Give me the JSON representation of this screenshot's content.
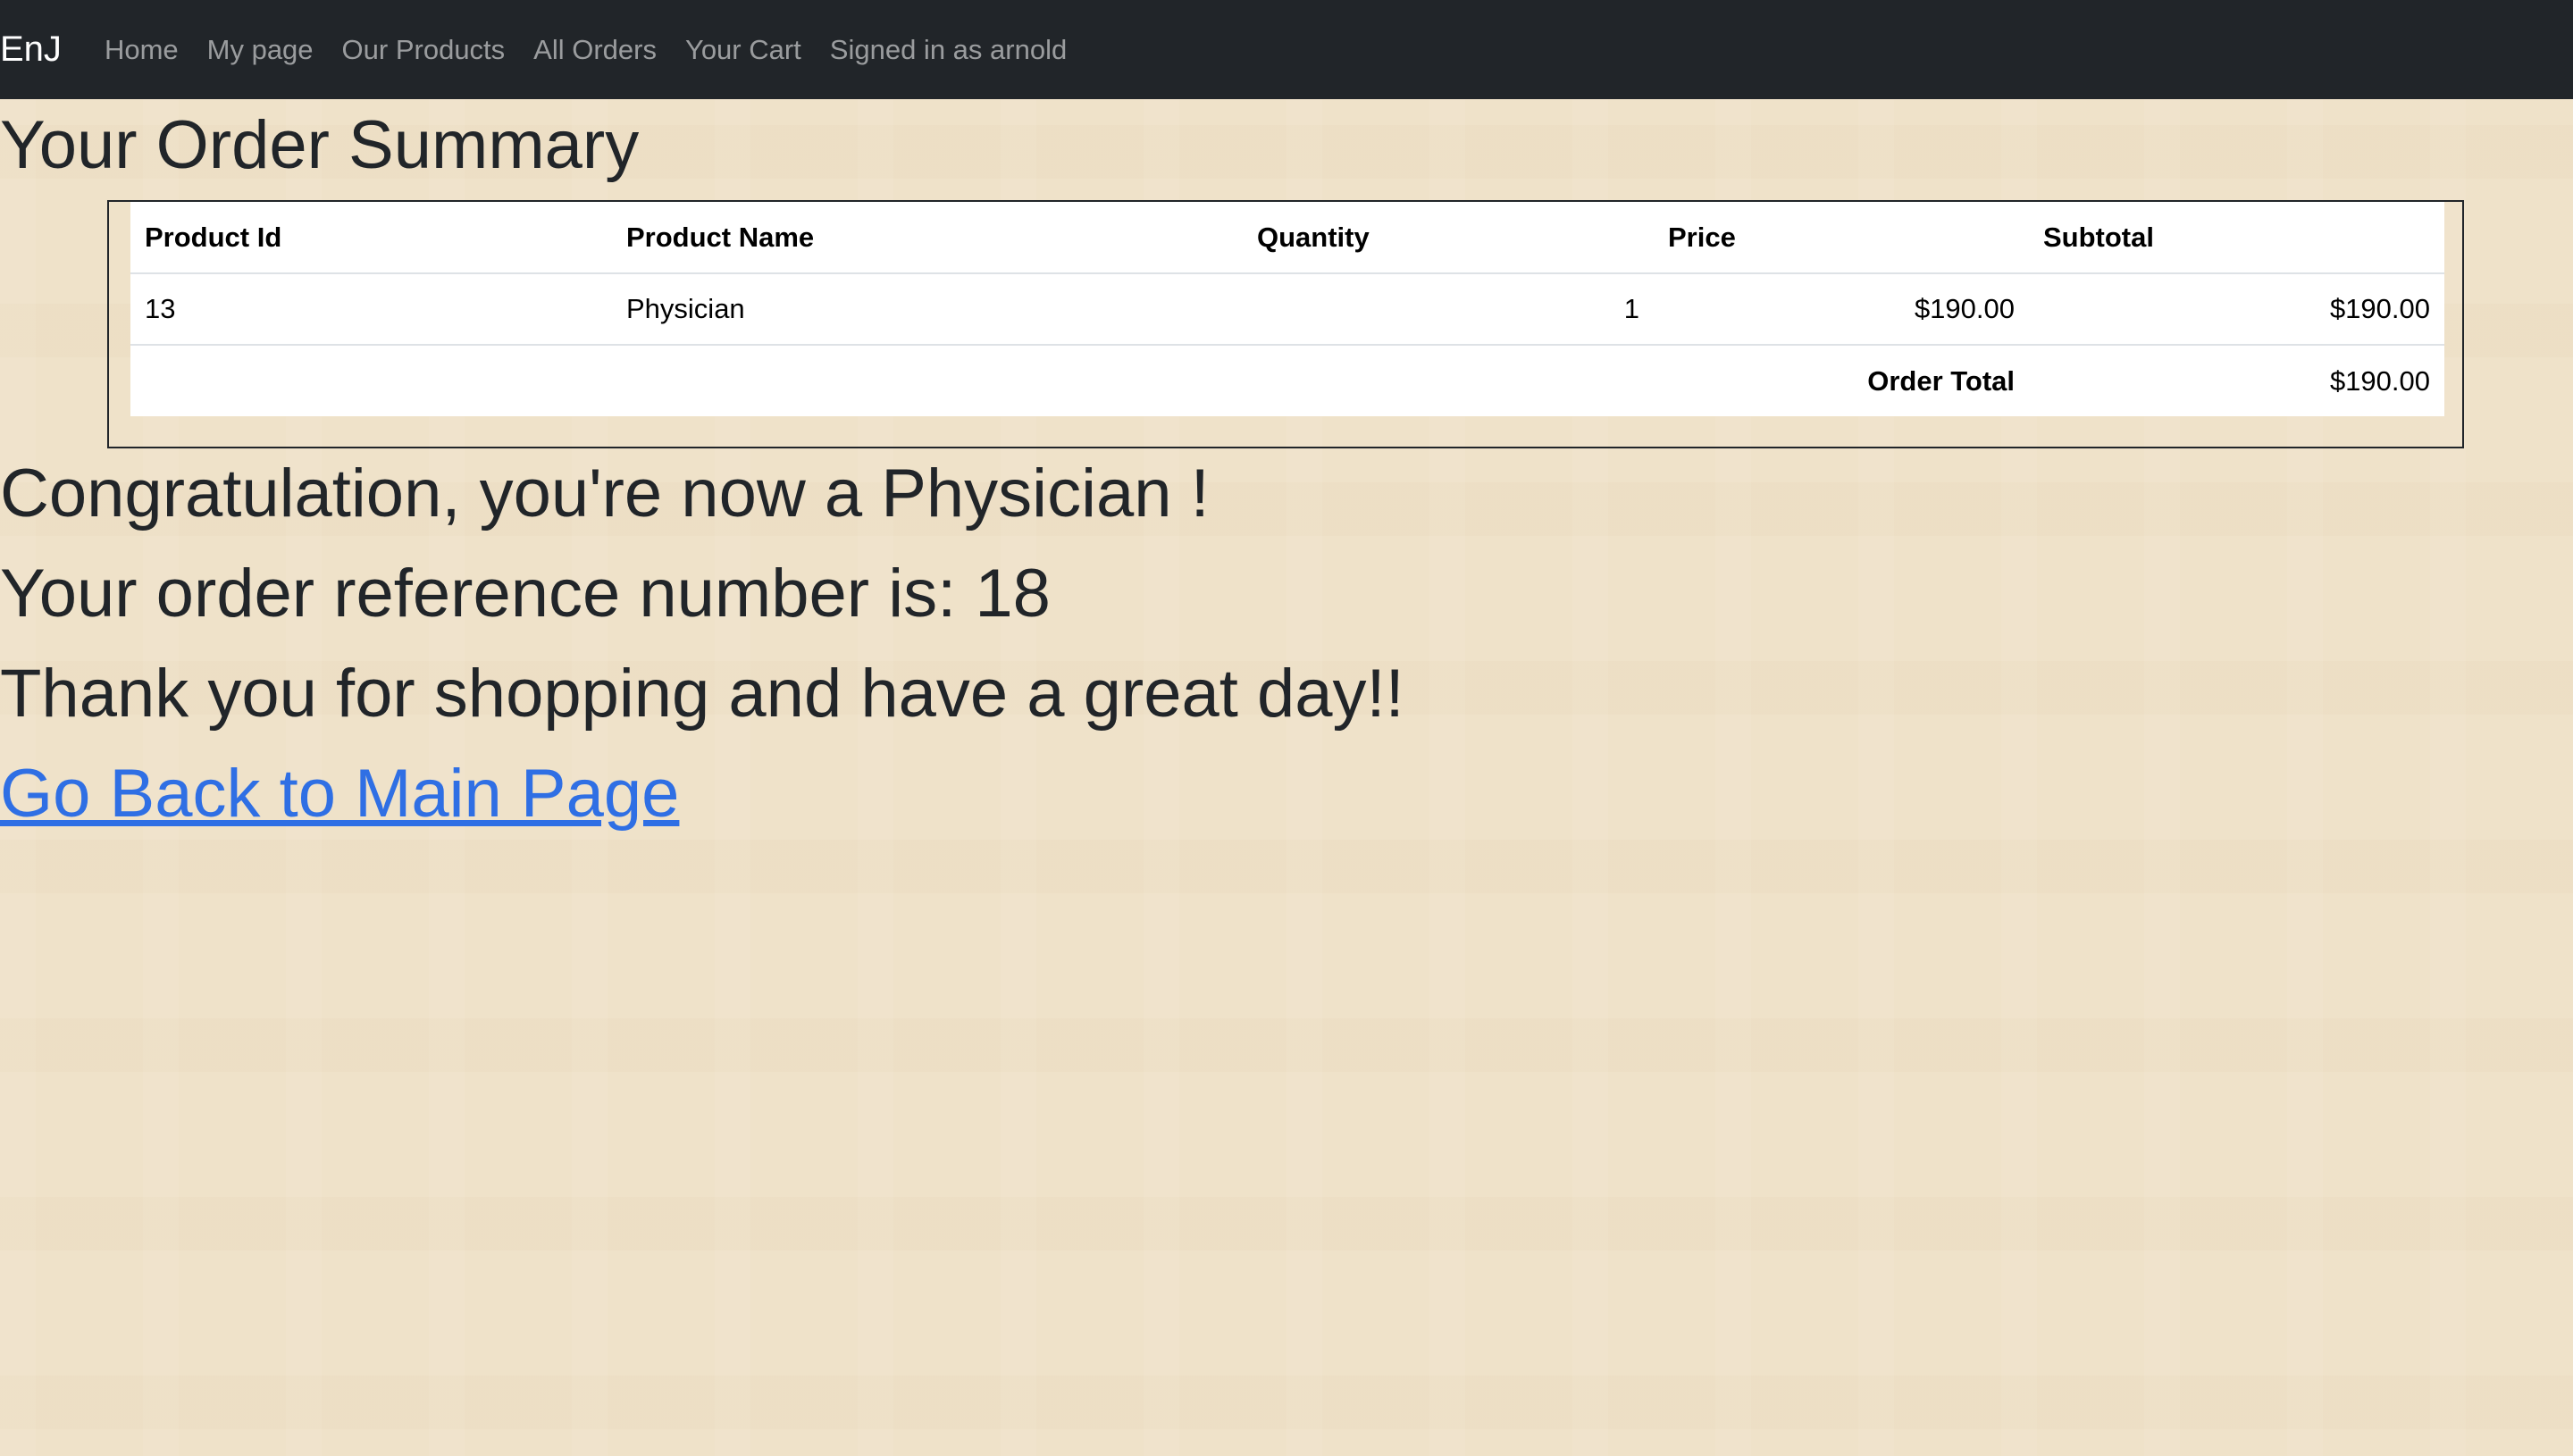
{
  "navbar": {
    "brand": "EnJ",
    "links": [
      "Home",
      "My page",
      "Our Products",
      "All Orders",
      "Your Cart",
      "Signed in as arnold"
    ]
  },
  "page_title": "Your Order Summary",
  "table": {
    "headers": [
      "Product Id",
      "Product Name",
      "Quantity",
      "Price",
      "Subtotal"
    ],
    "rows": [
      {
        "id": "13",
        "name": "Physician",
        "quantity": "1",
        "price": "$190.00",
        "subtotal": "$190.00"
      }
    ],
    "total_label": "Order Total",
    "total_value": "$190.00"
  },
  "messages": {
    "congrats": "Congratulation, you're now a Physician !",
    "reference": "Your order reference number is: 18",
    "thanks": "Thank you for shopping and have a great day!!"
  },
  "back_link": "Go Back to Main Page",
  "colors": {
    "navbar_bg": "#212529",
    "page_bg": "#efe2c9",
    "link": "#2f6fe4"
  }
}
